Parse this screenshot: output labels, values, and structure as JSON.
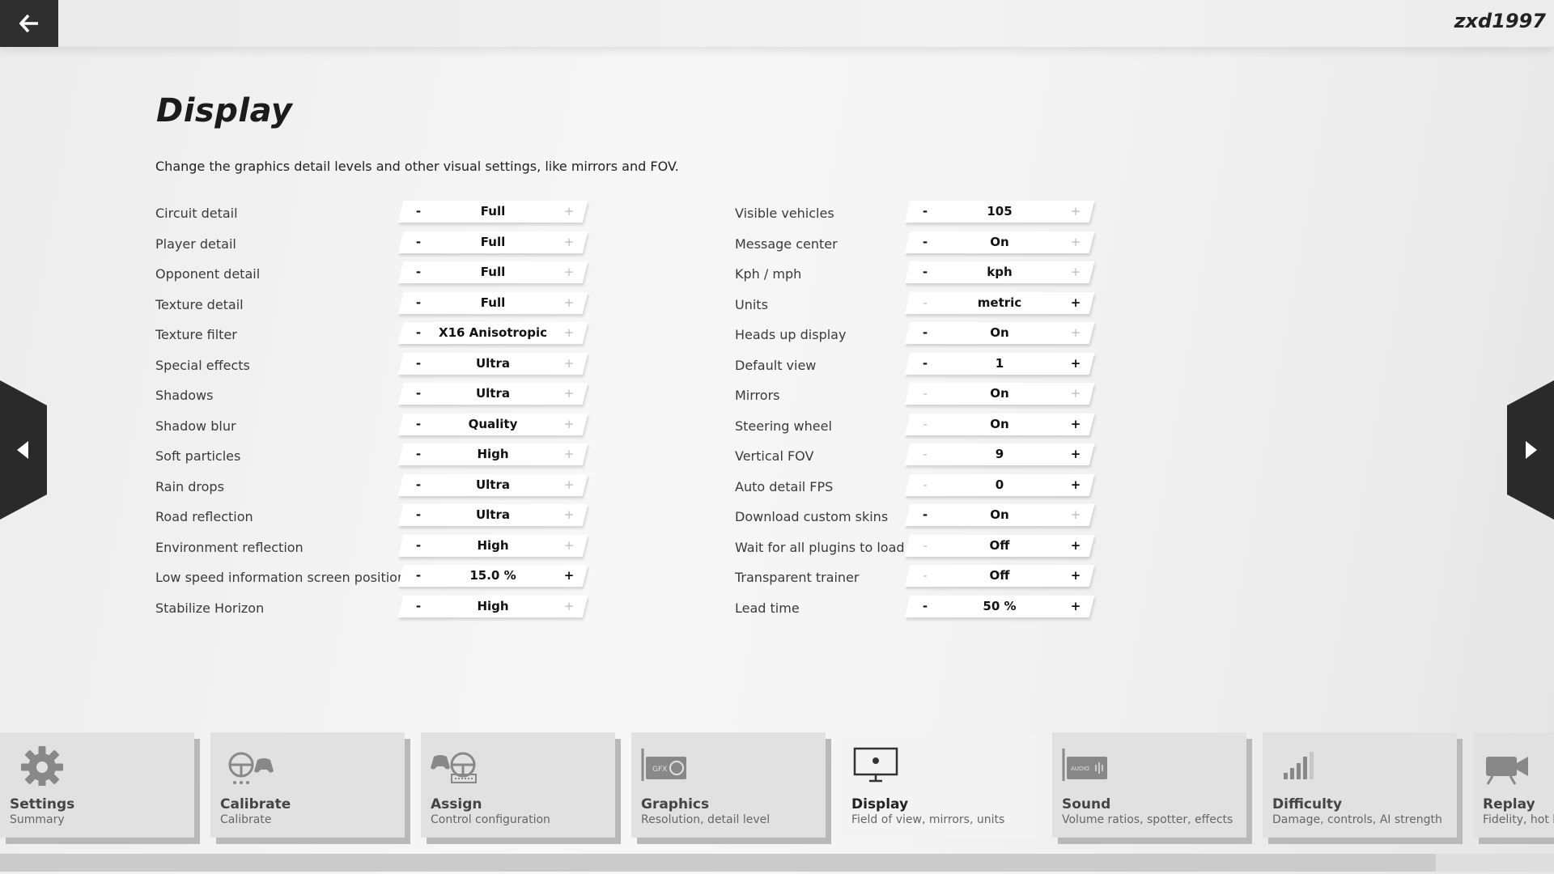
{
  "header": {
    "username": "zxd1997"
  },
  "page": {
    "title": "Display",
    "description": "Change the graphics detail levels and other visual settings, like mirrors and FOV."
  },
  "left_settings": [
    {
      "label": "Circuit detail",
      "value": "Full",
      "minus_enabled": true,
      "plus_enabled": false
    },
    {
      "label": "Player detail",
      "value": "Full",
      "minus_enabled": true,
      "plus_enabled": false
    },
    {
      "label": "Opponent detail",
      "value": "Full",
      "minus_enabled": true,
      "plus_enabled": false
    },
    {
      "label": "Texture detail",
      "value": "Full",
      "minus_enabled": true,
      "plus_enabled": false
    },
    {
      "label": "Texture filter",
      "value": "X16 Anisotropic",
      "minus_enabled": true,
      "plus_enabled": false
    },
    {
      "label": "Special effects",
      "value": "Ultra",
      "minus_enabled": true,
      "plus_enabled": false
    },
    {
      "label": "Shadows",
      "value": "Ultra",
      "minus_enabled": true,
      "plus_enabled": false
    },
    {
      "label": "Shadow blur",
      "value": "Quality",
      "minus_enabled": true,
      "plus_enabled": false
    },
    {
      "label": "Soft particles",
      "value": "High",
      "minus_enabled": true,
      "plus_enabled": false
    },
    {
      "label": "Rain drops",
      "value": "Ultra",
      "minus_enabled": true,
      "plus_enabled": false
    },
    {
      "label": "Road reflection",
      "value": "Ultra",
      "minus_enabled": true,
      "plus_enabled": false
    },
    {
      "label": "Environment reflection",
      "value": "High",
      "minus_enabled": true,
      "plus_enabled": false
    },
    {
      "label": "Low speed information screen position",
      "value": "15.0 %",
      "minus_enabled": true,
      "plus_enabled": true
    },
    {
      "label": "Stabilize Horizon",
      "value": "High",
      "minus_enabled": true,
      "plus_enabled": false
    }
  ],
  "right_settings": [
    {
      "label": "Visible vehicles",
      "value": "105",
      "minus_enabled": true,
      "plus_enabled": false
    },
    {
      "label": "Message center",
      "value": "On",
      "minus_enabled": true,
      "plus_enabled": false
    },
    {
      "label": "Kph / mph",
      "value": "kph",
      "minus_enabled": true,
      "plus_enabled": false
    },
    {
      "label": "Units",
      "value": "metric",
      "minus_enabled": false,
      "plus_enabled": true
    },
    {
      "label": "Heads up display",
      "value": "On",
      "minus_enabled": true,
      "plus_enabled": false
    },
    {
      "label": "Default view",
      "value": "1",
      "minus_enabled": true,
      "plus_enabled": true
    },
    {
      "label": "Mirrors",
      "value": "On",
      "minus_enabled": false,
      "plus_enabled": false
    },
    {
      "label": "Steering wheel",
      "value": "On",
      "minus_enabled": false,
      "plus_enabled": true
    },
    {
      "label": "Vertical FOV",
      "value": "9",
      "minus_enabled": false,
      "plus_enabled": true
    },
    {
      "label": "Auto detail FPS",
      "value": "0",
      "minus_enabled": false,
      "plus_enabled": true
    },
    {
      "label": "Download custom skins",
      "value": "On",
      "minus_enabled": true,
      "plus_enabled": false
    },
    {
      "label": "Wait for all plugins to load",
      "value": "Off",
      "minus_enabled": false,
      "plus_enabled": true
    },
    {
      "label": "Transparent trainer",
      "value": "Off",
      "minus_enabled": false,
      "plus_enabled": true
    },
    {
      "label": "Lead time",
      "value": "50 %",
      "minus_enabled": true,
      "plus_enabled": true
    }
  ],
  "controls": {
    "minus_glyph": "-",
    "plus_glyph": "+"
  },
  "tabs": [
    {
      "title": "Settings",
      "subtitle": "Summary",
      "icon": "gear-icon"
    },
    {
      "title": "Calibrate",
      "subtitle": "Calibrate",
      "icon": "steering-gamepad-icon"
    },
    {
      "title": "Assign",
      "subtitle": "Control configuration",
      "icon": "controller-keyboard-icon"
    },
    {
      "title": "Graphics",
      "subtitle": "Resolution, detail level",
      "icon": "gpu-card-icon",
      "badge": "GFX"
    },
    {
      "title": "Display",
      "subtitle": "Field of view, mirrors, units",
      "icon": "monitor-icon",
      "active": true
    },
    {
      "title": "Sound",
      "subtitle": "Volume ratios, spotter, effects",
      "icon": "sound-card-icon",
      "badge": "AUDIO"
    },
    {
      "title": "Difficulty",
      "subtitle": "Damage, controls, AI strength",
      "icon": "bars-icon"
    },
    {
      "title": "Replay",
      "subtitle": "Fidelity, hot k",
      "icon": "camera-icon"
    }
  ],
  "colors": {
    "dark": "#2a2a2a",
    "active_tab": "#f3f3f3",
    "tab": "#e1e1e1"
  }
}
